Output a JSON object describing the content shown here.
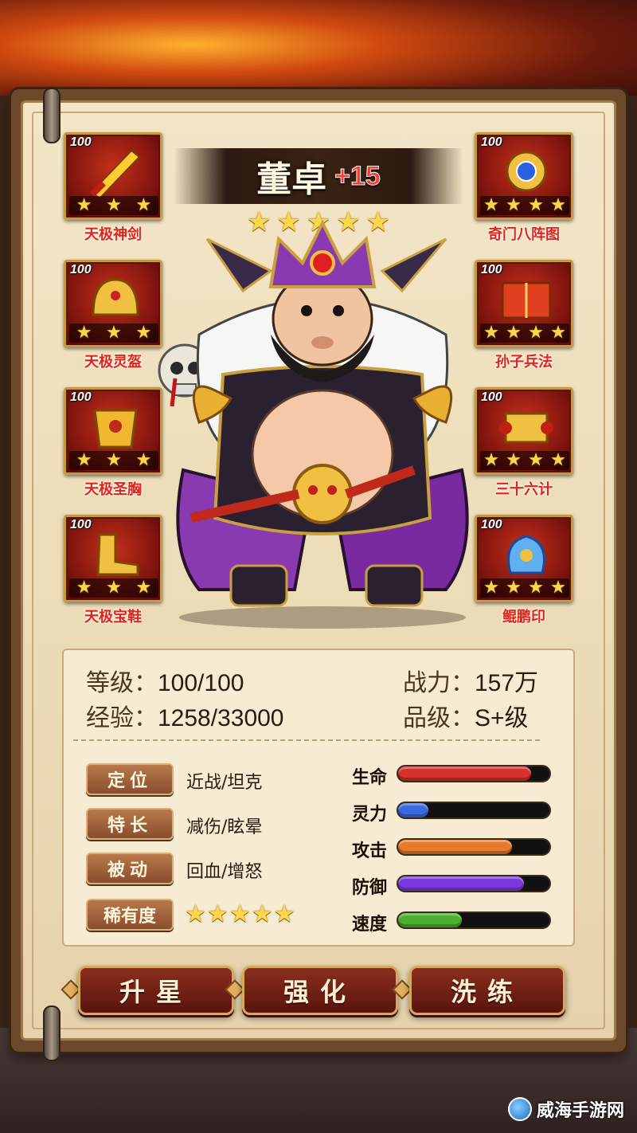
{
  "hero": {
    "name": "董卓",
    "plus_level": "+15",
    "star_count": 5,
    "star_glyph": "★"
  },
  "equipment_left": [
    {
      "level": "100",
      "name": "天极神剑",
      "stars": 3,
      "icon": "sword-icon"
    },
    {
      "level": "100",
      "name": "天极灵盔",
      "stars": 3,
      "icon": "helmet-icon"
    },
    {
      "level": "100",
      "name": "天极圣胸",
      "stars": 3,
      "icon": "armor-icon"
    },
    {
      "level": "100",
      "name": "天极宝鞋",
      "stars": 3,
      "icon": "boots-icon"
    }
  ],
  "equipment_right": [
    {
      "level": "100",
      "name": "奇门八阵图",
      "stars": 4,
      "icon": "formation-scroll-icon"
    },
    {
      "level": "100",
      "name": "孙子兵法",
      "stars": 4,
      "icon": "book-icon"
    },
    {
      "level": "100",
      "name": "三十六计",
      "stars": 4,
      "icon": "scroll-icon"
    },
    {
      "level": "100",
      "name": "鲲鹏印",
      "stars": 4,
      "icon": "seal-icon"
    }
  ],
  "info": {
    "level_label": "等级：",
    "level_value": "100/100",
    "exp_label": "经验：",
    "exp_value": "1258/33000",
    "power_label": "战力：",
    "power_value": "157万",
    "grade_label": "品级：",
    "grade_value": "S+级"
  },
  "traits": [
    {
      "tag": "定位",
      "value": "近战/坦克"
    },
    {
      "tag": "特长",
      "value": "减伤/眩晕"
    },
    {
      "tag": "被动",
      "value": "回血/增怒"
    },
    {
      "tag": "稀有度",
      "value": ""
    }
  ],
  "rarity_stars": 5,
  "stats": [
    {
      "label": "生命",
      "fill": 0.88,
      "color": "#d8302a"
    },
    {
      "label": "灵力",
      "fill": 0.2,
      "color": "#3a6ae0"
    },
    {
      "label": "攻击",
      "fill": 0.75,
      "color": "#ea7a2a"
    },
    {
      "label": "防御",
      "fill": 0.83,
      "color": "#7a3ae0"
    },
    {
      "label": "速度",
      "fill": 0.42,
      "color": "#4ab030"
    }
  ],
  "buttons": [
    "升星",
    "强化",
    "洗练"
  ],
  "watermark": "威海手游网",
  "colors": {
    "accent_red": "#e0241a",
    "gold": "#ffd84a",
    "parchment": "#f3e6c8"
  }
}
